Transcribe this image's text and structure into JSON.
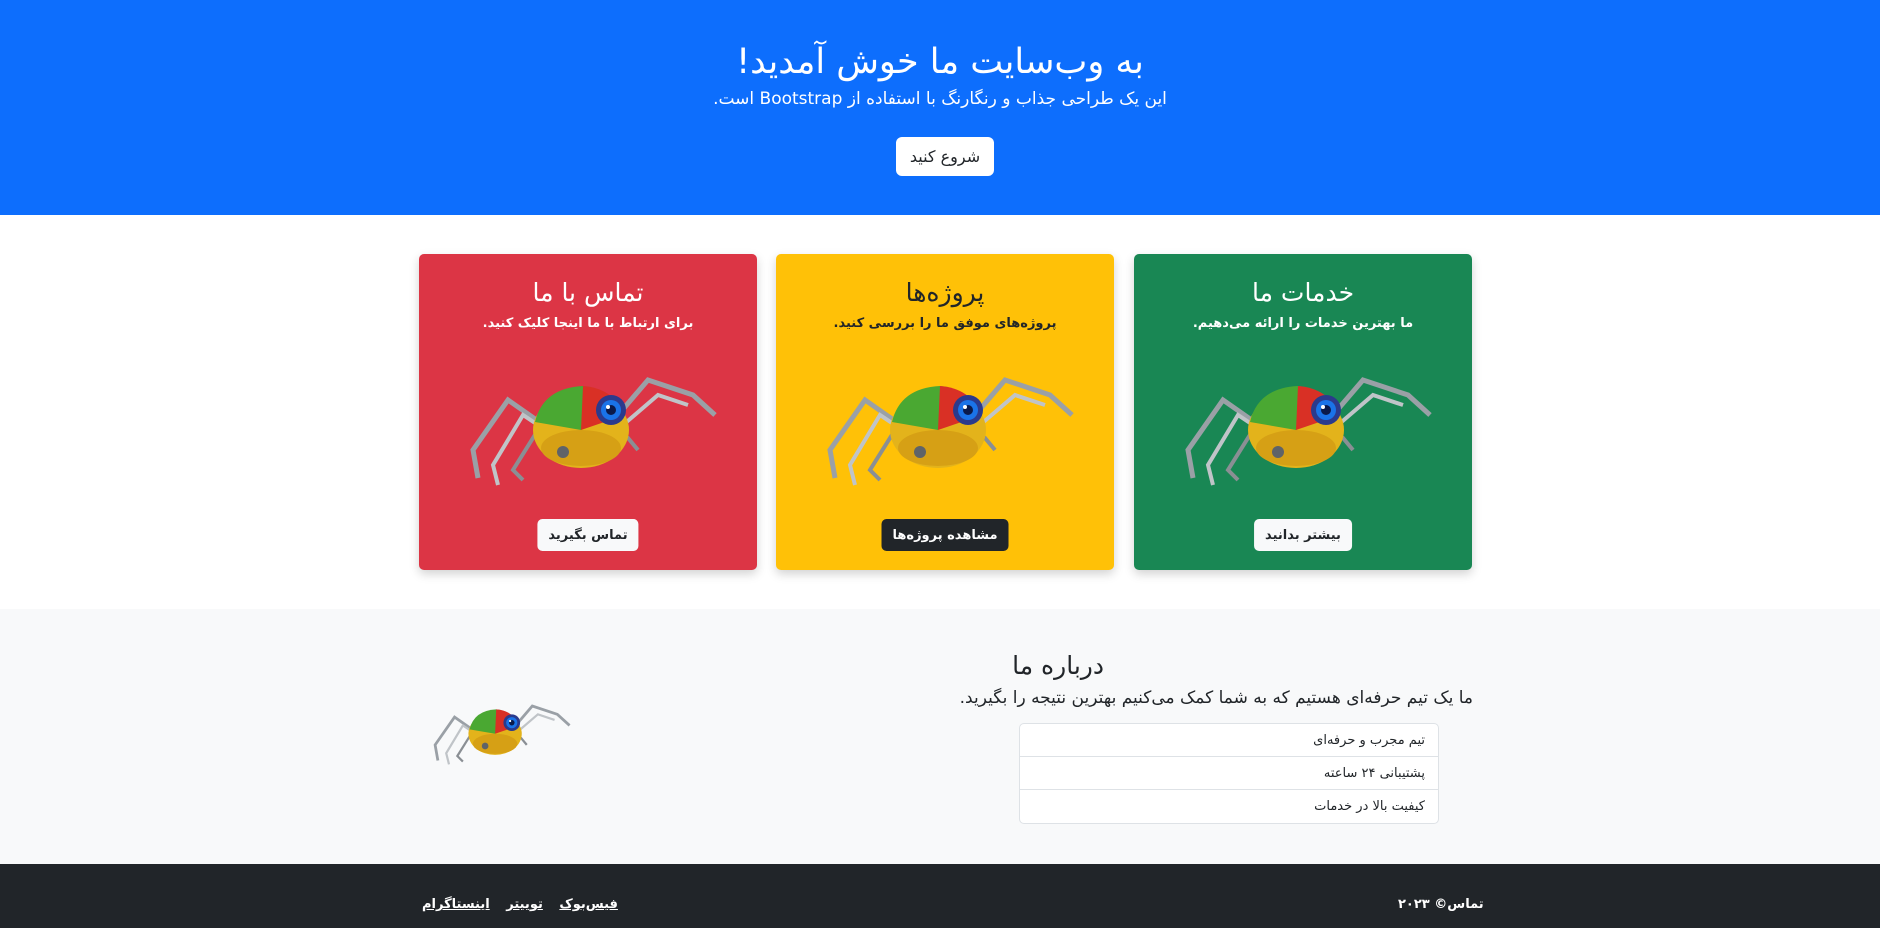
{
  "hero": {
    "title": "به وب‌سایت ما خوش آمدید!",
    "subtitle": "این یک طراحی جذاب و رنگارنگ با استفاده از Bootstrap است.",
    "button_label": "شروع کنید"
  },
  "cards": [
    {
      "title": "خدمات ما",
      "text": "ما بهترین خدمات را ارائه می‌دهیم.",
      "button_label": "بیشتر بدانید",
      "color": "#198754"
    },
    {
      "title": "پروژه‌ها",
      "text": "پروژه‌های موفق ما را بررسی کنید.",
      "button_label": "مشاهده پروژه‌ها",
      "color": "#ffc107"
    },
    {
      "title": "تماس با ما",
      "text": "برای ارتباط با ما اینجا کلیک کنید.",
      "button_label": "تماس بگیرید",
      "color": "#dc3545"
    }
  ],
  "about": {
    "title": "درباره ما",
    "lead": "ما یک تیم حرفه‌ای هستیم که به شما کمک می‌کنیم بهترین نتیجه را بگیرید.",
    "items": [
      "تیم مجرب و حرفه‌ای",
      "پشتیبانی ۲۴ ساعته",
      "کیفیت بالا در خدمات"
    ]
  },
  "footer": {
    "copyright": "تماس© ۲۰۲۳",
    "links": [
      "فیس‌بوک",
      "توییتر",
      "اینستاگرام"
    ]
  },
  "colors": {
    "primary": "#0d6efd",
    "success": "#198754",
    "warning": "#ffc107",
    "danger": "#dc3545",
    "dark": "#212529",
    "light": "#f8f9fa"
  },
  "icons": {
    "card_image": "robot-spider-illustration",
    "about_image": "robot-spider-illustration"
  }
}
